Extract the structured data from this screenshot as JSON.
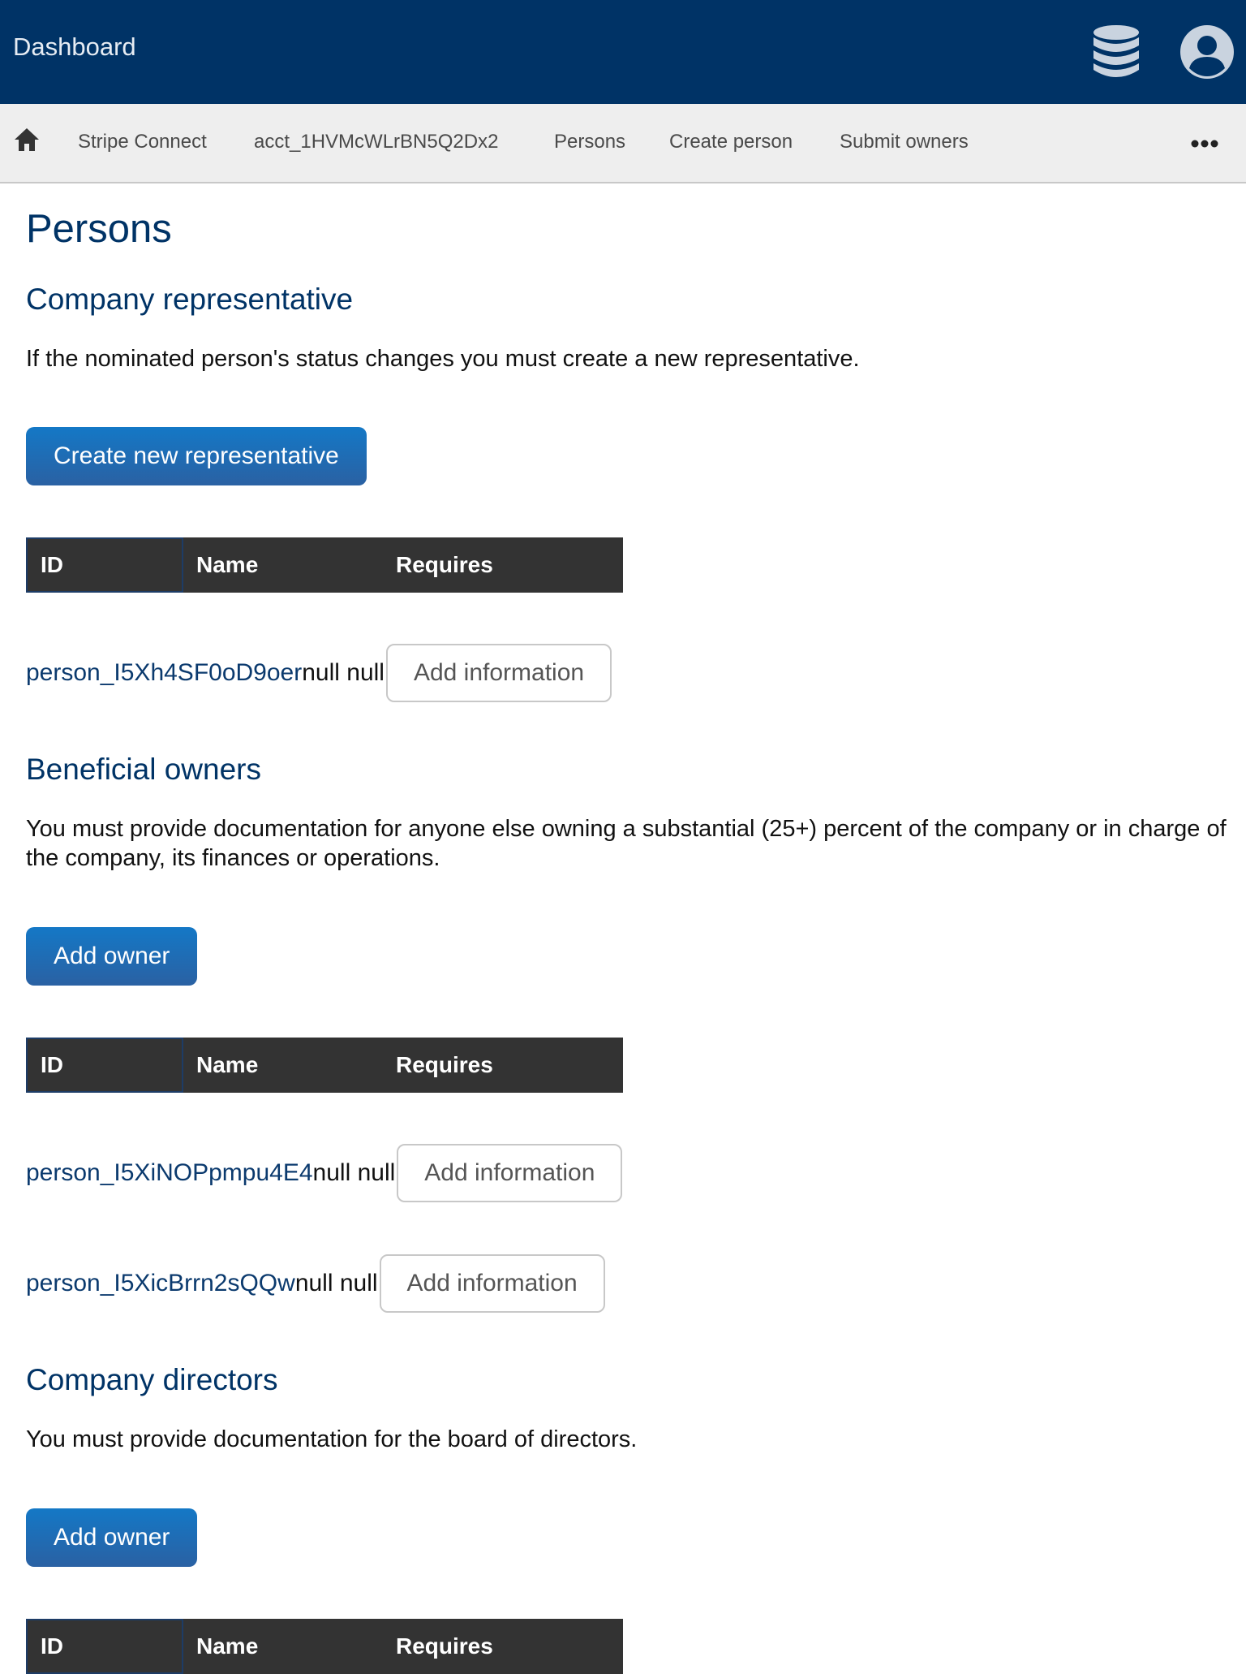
{
  "header": {
    "title": "Dashboard",
    "icons": [
      "database-icon",
      "user-account-icon"
    ]
  },
  "breadcrumb": {
    "home_icon": "home-icon",
    "items": [
      "Stripe Connect",
      "acct_1HVMcWLrBN5Q2Dx2",
      "Persons",
      "Create person",
      "Submit owners"
    ],
    "more_icon": "ellipsis-icon"
  },
  "page": {
    "title": "Persons"
  },
  "table_headers": {
    "id": "ID",
    "name": "Name",
    "requires": "Requires"
  },
  "representative": {
    "heading": "Company representative",
    "description": "If the nominated person's status changes you must create a new representative.",
    "button": "Create new representative",
    "rows": [
      {
        "id": "person_I5Xh4SF0oD9oer",
        "name": "null null",
        "action": "Add information"
      }
    ]
  },
  "owners": {
    "heading": "Beneficial owners",
    "description": "You must provide documentation for anyone else owning a substantial (25+) percent of the company or in charge of the company, its finances or operations.",
    "button": "Add owner",
    "rows": [
      {
        "id": "person_I5XiNOPpmpu4E4",
        "name": "null null",
        "action": "Add information"
      },
      {
        "id": "person_I5XicBrrn2sQQw",
        "name": "null null",
        "action": "Add information"
      }
    ]
  },
  "directors": {
    "heading": "Company directors",
    "description": "You must provide documentation for the board of directors.",
    "button": "Add owner"
  },
  "colors": {
    "header_bg": "#003366",
    "nav_bg": "#eeeeee",
    "heading": "#003366",
    "primary_button": "#1a6fb8",
    "table_header_bg": "#333333"
  }
}
